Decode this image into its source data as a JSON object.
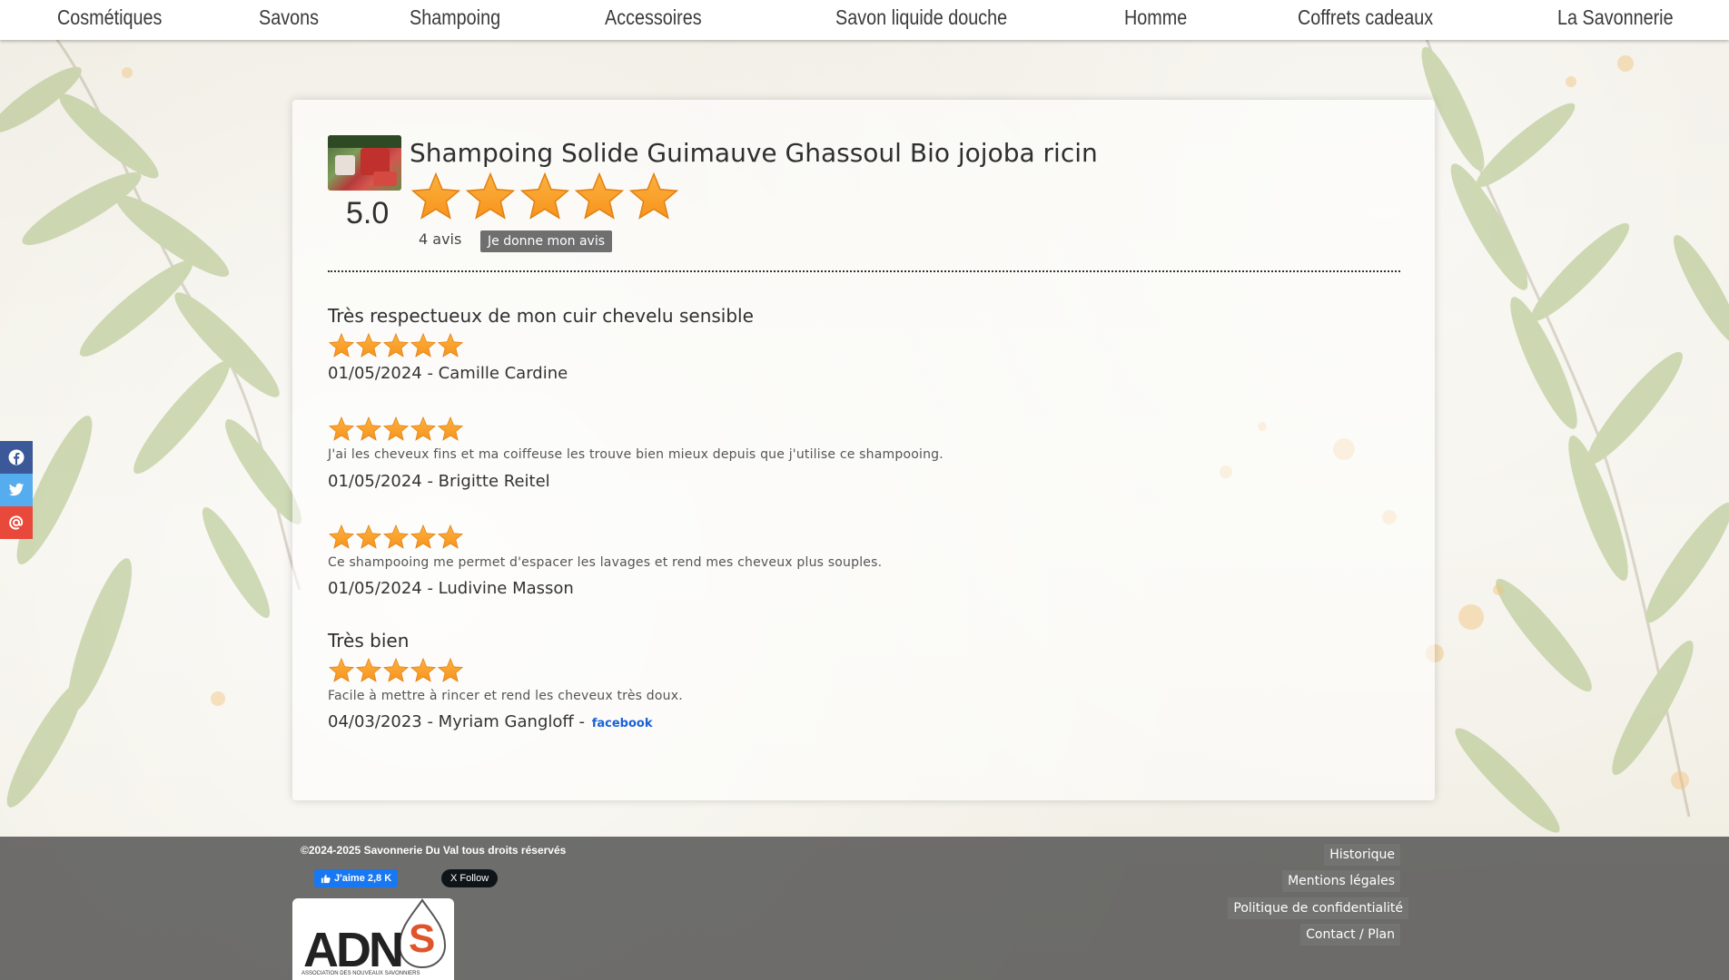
{
  "nav": {
    "items": [
      "Cosmétiques",
      "Savons",
      "Shampoing",
      "Accessoires",
      "Savon liquide douche",
      "Homme",
      "Coffrets cadeaux",
      "La Savonnerie"
    ]
  },
  "product": {
    "title": "Shampoing Solide Guimauve Ghassoul Bio jojoba ricin",
    "score": "5.0",
    "rating": 5,
    "review_count": "4 avis",
    "review_button": "Je donne mon avis"
  },
  "reviews": [
    {
      "title": "Très respectueux de mon cuir chevelu sensible",
      "rating": 5,
      "text": "",
      "date_author": "01/05/2024 - Camille Cardine",
      "source": ""
    },
    {
      "title": "",
      "rating": 5,
      "text": "J'ai les cheveux fins et ma coiffeuse les trouve bien mieux depuis que j'utilise ce shampooing.",
      "date_author": "01/05/2024 - Brigitte Reitel",
      "source": ""
    },
    {
      "title": "",
      "rating": 5,
      "text": "Ce shampooing me permet d'espacer les lavages et rend mes cheveux plus souples.",
      "date_author": "01/05/2024 - Ludivine Masson",
      "source": ""
    },
    {
      "title": "Très bien",
      "rating": 5,
      "text": "Facile à mettre à rincer et rend les cheveux très doux.",
      "date_author": "04/03/2023 - Myriam Gangloff - ",
      "source": "facebook"
    }
  ],
  "social": {
    "icons": [
      "facebook-icon",
      "twitter-icon",
      "email-at-icon"
    ],
    "colors": {
      "facebook": "#3b5998",
      "twitter": "#55acee",
      "email": "#e8493b"
    }
  },
  "footer": {
    "copyright": "©2024-2025 Savonnerie Du Val tous droits réservés",
    "fb_like": "J'aime 2,8 K",
    "x_follow": "X Follow",
    "links": [
      "Historique",
      "Mentions légales",
      "Politique de confidentialité",
      "Contact / Plan"
    ],
    "logo_text": "ADN",
    "logo_letter": "S",
    "logo_caption": "ASSOCIATION DES NOUVEAUX SAVONNIERS"
  },
  "colors": {
    "star": "#f7941d",
    "star_light": "#fcb13f",
    "button_bg": "#6f6f6f",
    "link_blue": "#1a62d4",
    "footer_bg": "#4b4b4b"
  }
}
